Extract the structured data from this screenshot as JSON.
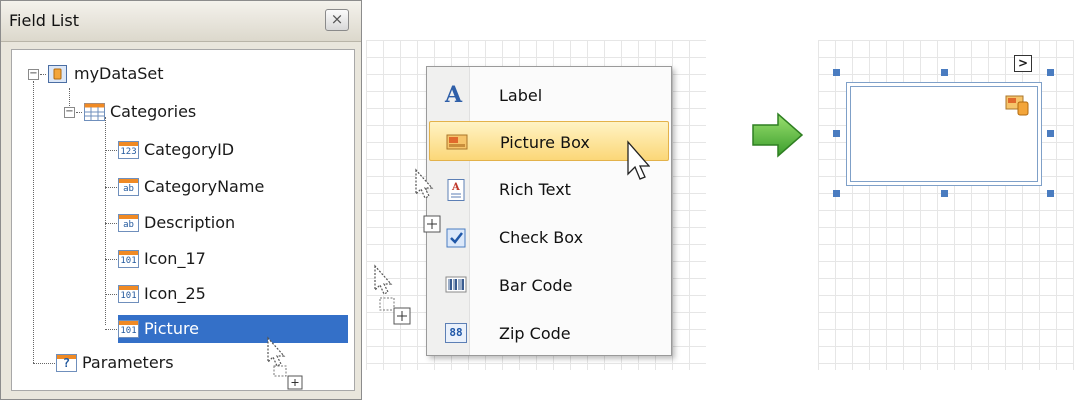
{
  "field_list": {
    "title": "Field List",
    "close_label": "×",
    "root": {
      "label": "myDataSet"
    },
    "table": {
      "label": "Categories"
    },
    "fields": [
      {
        "label": "CategoryID",
        "type_badge": "123"
      },
      {
        "label": "CategoryName",
        "type_badge": "ab"
      },
      {
        "label": "Description",
        "type_badge": "ab"
      },
      {
        "label": "Icon_17",
        "type_badge": "101"
      },
      {
        "label": "Icon_25",
        "type_badge": "101"
      },
      {
        "label": "Picture",
        "type_badge": "101",
        "selected": true
      }
    ],
    "parameters": {
      "label": "Parameters",
      "badge": "?"
    }
  },
  "context_menu": {
    "items": [
      {
        "label": "Label",
        "icon": "label-icon"
      },
      {
        "label": "Picture Box",
        "icon": "picture-box-icon",
        "highlighted": true
      },
      {
        "label": "Rich Text",
        "icon": "rich-text-icon"
      },
      {
        "label": "Check Box",
        "icon": "check-box-icon"
      },
      {
        "label": "Bar Code",
        "icon": "bar-code-icon"
      },
      {
        "label": "Zip Code",
        "icon": "zip-code-icon"
      }
    ],
    "glyphs": {
      "label": "A",
      "zip": "88"
    }
  },
  "smart_tag": {
    "glyph": ">"
  },
  "colors": {
    "selection": "#3470c8",
    "menu_highlight": "#fbd778",
    "arrow_green": "#4bb43a",
    "handle_blue": "#4a7cc0"
  }
}
